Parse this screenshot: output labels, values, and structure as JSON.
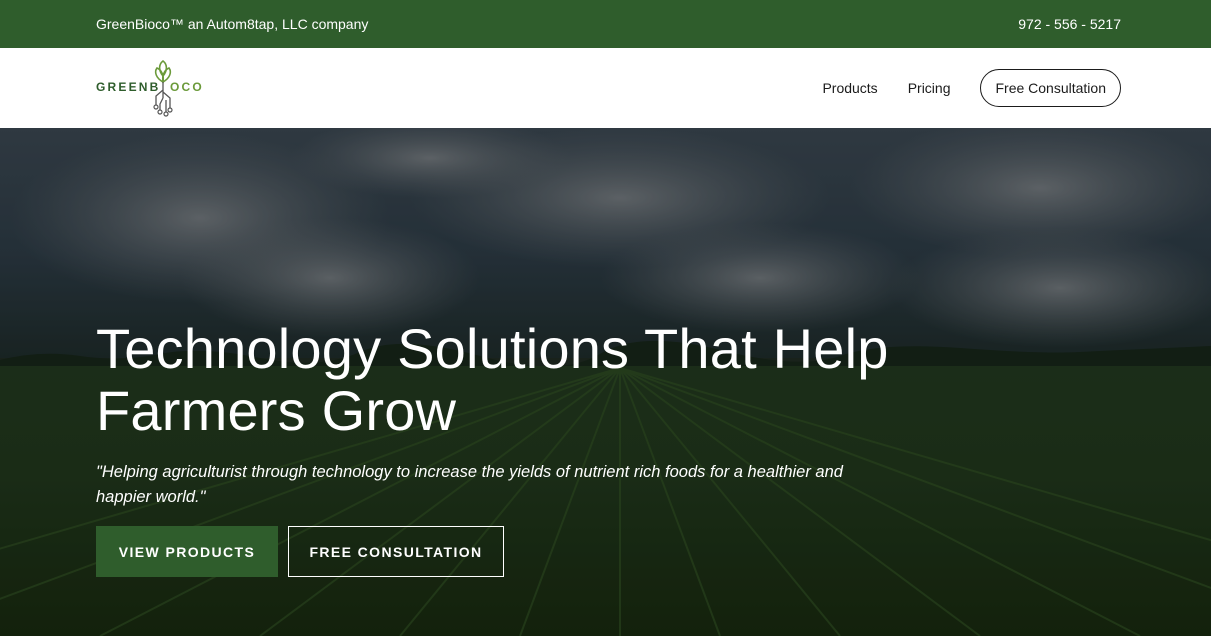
{
  "topbar": {
    "company_text": "GreenBioco™ an Autom8tap, LLC company",
    "phone": "972 - 556 - 5217"
  },
  "logo": {
    "text_left": "GREENB",
    "text_right": "OCO",
    "icon": "sprout-circuit-icon"
  },
  "nav": {
    "items": [
      {
        "label": "Products"
      },
      {
        "label": "Pricing"
      }
    ],
    "cta_label": "Free Consultation"
  },
  "hero": {
    "title_line1": "Technology Solutions That Help",
    "title_line2": "Farmers Grow",
    "quote": "\"Helping agriculturist through technology to increase the yields of nutrient rich foods for a healthier and happier world.\"",
    "primary_button": "VIEW PRODUCTS",
    "secondary_button": "FREE CONSULTATION"
  },
  "colors": {
    "brand_green": "#2f5d2c",
    "logo_green": "#6b9a3a",
    "text_dark": "#1b1b1b",
    "white": "#ffffff"
  }
}
